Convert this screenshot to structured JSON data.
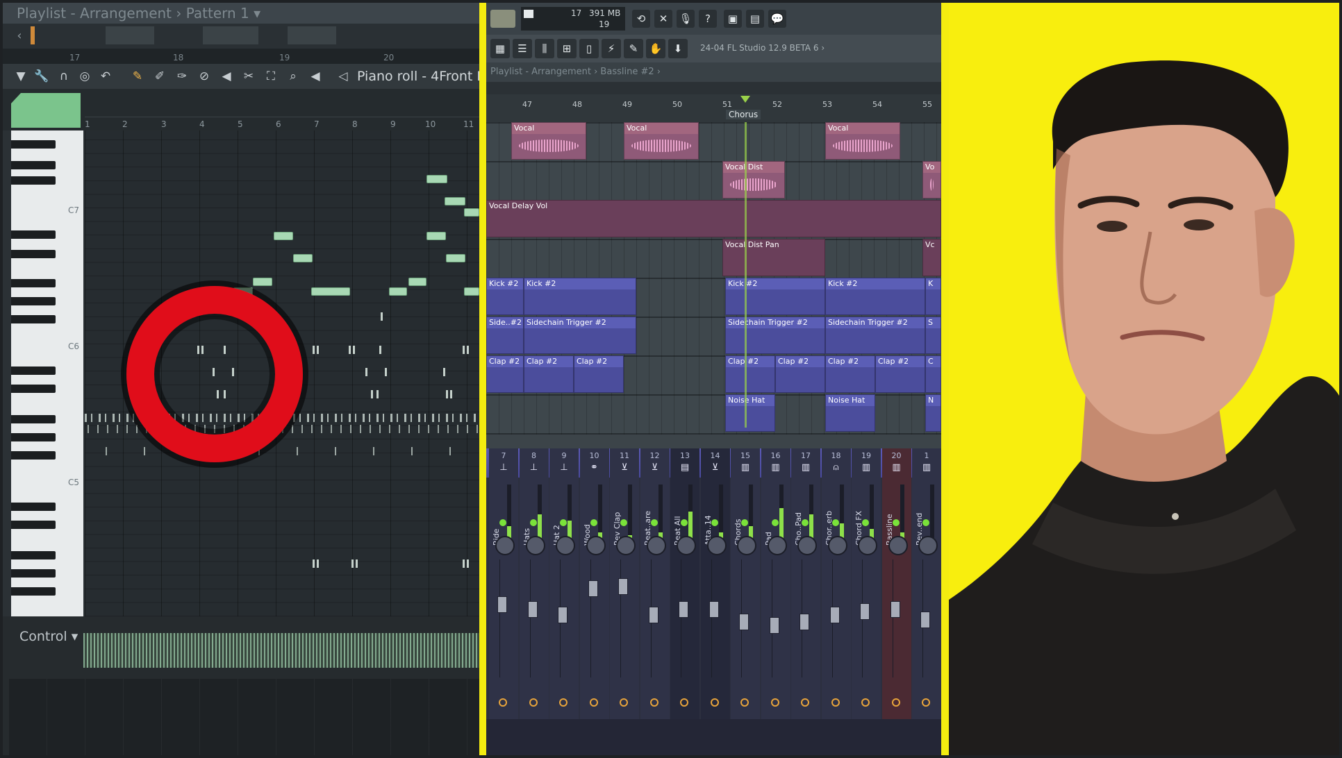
{
  "piano_roll": {
    "header_title": "Playlist - Arrangement › Pattern 1 ▾",
    "window_title": "Piano roll - 4Front P",
    "timeline_numbers": [
      "17",
      "18",
      "19",
      "20"
    ],
    "bar_numbers": [
      "1",
      "2",
      "3",
      "4",
      "5",
      "6",
      "7",
      "8",
      "9",
      "10",
      "11"
    ],
    "key_labels": [
      "C7",
      "C6",
      "C5"
    ],
    "control_label": "Control ▾"
  },
  "playlist": {
    "cpu_value": "17",
    "memory_value": "391 MB",
    "poly_value": "19",
    "version_prefix": "24-04",
    "version": "FL Studio 12.9 BETA 6",
    "breadcrumb": "Playlist - Arrangement › Bassline #2 ›",
    "bar_numbers": [
      "47",
      "48",
      "49",
      "50",
      "51",
      "52",
      "53",
      "54",
      "55"
    ],
    "marker": "Chorus",
    "clips": {
      "vocal": "Vocal",
      "vocal_dist": "Vocal Dist",
      "vocal_delay_vol": "Vocal Delay Vol",
      "vocal_dist_pan": "Vocal Dist Pan",
      "kick": "Kick #2",
      "sidechain_short": "Side..#2",
      "sidechain": "Sidechain Trigger #2",
      "clap": "Clap #2",
      "noise_hat": "Noise Hat",
      "cut_vo": "Vo",
      "cut_vc": "Vc",
      "cut_k": "K",
      "cut_s": "S",
      "cut_c": "C",
      "cut_n": "N"
    }
  },
  "mixer": {
    "strips": [
      {
        "num": "7",
        "name": "Ride"
      },
      {
        "num": "8",
        "name": "Hats"
      },
      {
        "num": "9",
        "name": "Hat 2"
      },
      {
        "num": "10",
        "name": "Wood"
      },
      {
        "num": "11",
        "name": "Rev Clap"
      },
      {
        "num": "12",
        "name": "Beat..are"
      },
      {
        "num": "13",
        "name": "Beat All"
      },
      {
        "num": "14",
        "name": "Atta..14"
      },
      {
        "num": "15",
        "name": "Chords"
      },
      {
        "num": "16",
        "name": "Pad"
      },
      {
        "num": "17",
        "name": "Cho..Pad"
      },
      {
        "num": "18",
        "name": "Chor..erb"
      },
      {
        "num": "19",
        "name": "Chord FX"
      },
      {
        "num": "20",
        "name": "Bassline"
      },
      {
        "num": "1",
        "name": "Rev..end"
      }
    ]
  },
  "colors": {
    "highlight_ring": "#e00d1a",
    "background_yellow": "#f8ee0e",
    "piano_note": "#a8d8b4",
    "vocal_clip": "#8f5a78",
    "pattern_clip": "#4b4d9c"
  }
}
